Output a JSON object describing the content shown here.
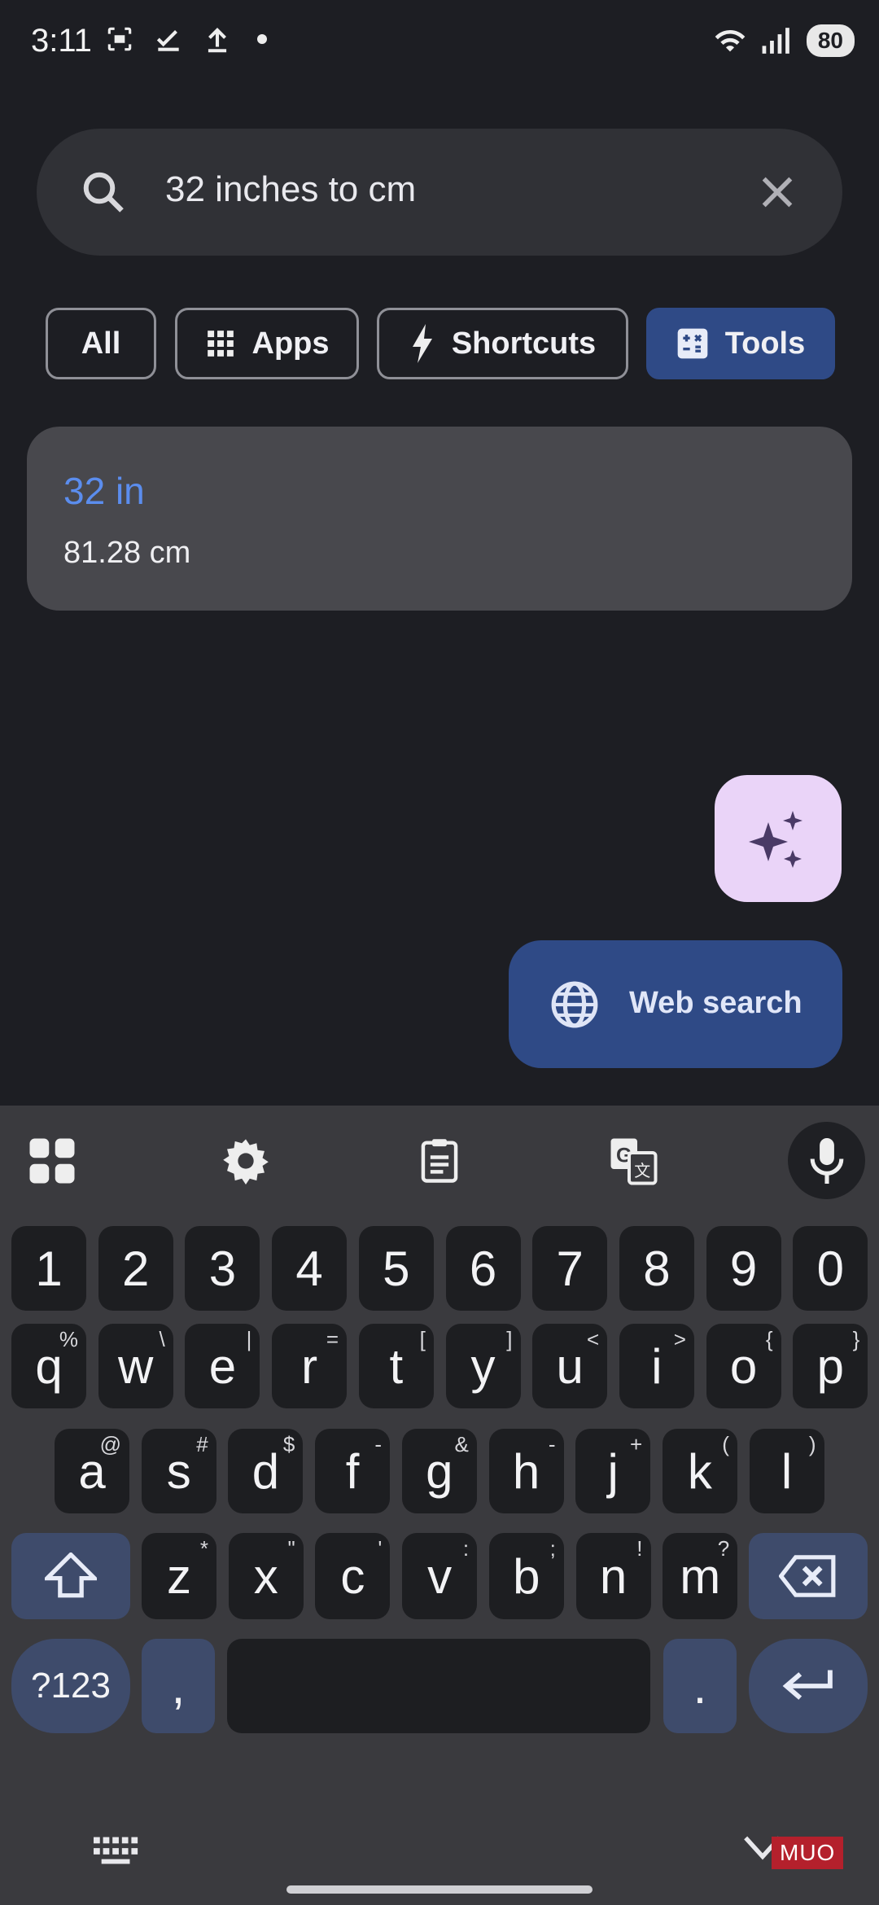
{
  "status_bar": {
    "time": "3:11",
    "battery": "80",
    "icons": [
      "screenshot-icon",
      "check-icon",
      "upload-icon",
      "dot-icon",
      "wifi-icon",
      "signal-icon"
    ]
  },
  "search": {
    "query": "32 inches to cm",
    "icons": [
      "search-icon",
      "clear-icon"
    ]
  },
  "filters": [
    {
      "label": "All",
      "selected": false
    },
    {
      "label": "Apps",
      "icon": "grid-icon",
      "selected": false
    },
    {
      "label": "Shortcuts",
      "icon": "bolt-icon",
      "selected": false
    },
    {
      "label": "Tools",
      "icon": "calculator-icon",
      "selected": true
    }
  ],
  "result": {
    "query": "32 in",
    "answer": "81.28 cm"
  },
  "fab": {
    "icon": "sparkle-icon"
  },
  "web_search": {
    "label": "Web search",
    "icon": "globe-icon"
  },
  "keyboard": {
    "toolbar": [
      "apps-grid-icon",
      "gear-icon",
      "clipboard-icon",
      "translate-icon",
      "mic-icon"
    ],
    "row_numbers": [
      "1",
      "2",
      "3",
      "4",
      "5",
      "6",
      "7",
      "8",
      "9",
      "0"
    ],
    "row1": [
      {
        "k": "q",
        "h": "%"
      },
      {
        "k": "w",
        "h": "\\"
      },
      {
        "k": "e",
        "h": "|"
      },
      {
        "k": "r",
        "h": "="
      },
      {
        "k": "t",
        "h": "["
      },
      {
        "k": "y",
        "h": "]"
      },
      {
        "k": "u",
        "h": "<"
      },
      {
        "k": "i",
        "h": ">"
      },
      {
        "k": "o",
        "h": "{"
      },
      {
        "k": "p",
        "h": "}"
      }
    ],
    "row2": [
      {
        "k": "a",
        "h": "@"
      },
      {
        "k": "s",
        "h": "#"
      },
      {
        "k": "d",
        "h": "$"
      },
      {
        "k": "f",
        "h": "-"
      },
      {
        "k": "g",
        "h": "&"
      },
      {
        "k": "h",
        "h": "-"
      },
      {
        "k": "j",
        "h": "+"
      },
      {
        "k": "k",
        "h": "("
      },
      {
        "k": "l",
        "h": ")"
      }
    ],
    "row3": [
      {
        "k": "z",
        "h": "*"
      },
      {
        "k": "x",
        "h": "\""
      },
      {
        "k": "c",
        "h": "'"
      },
      {
        "k": "v",
        "h": ":"
      },
      {
        "k": "b",
        "h": ";"
      },
      {
        "k": "n",
        "h": "!"
      },
      {
        "k": "m",
        "h": "?"
      }
    ],
    "symbols_label": "?123",
    "comma": ",",
    "period": "."
  },
  "watermark": "MUO"
}
